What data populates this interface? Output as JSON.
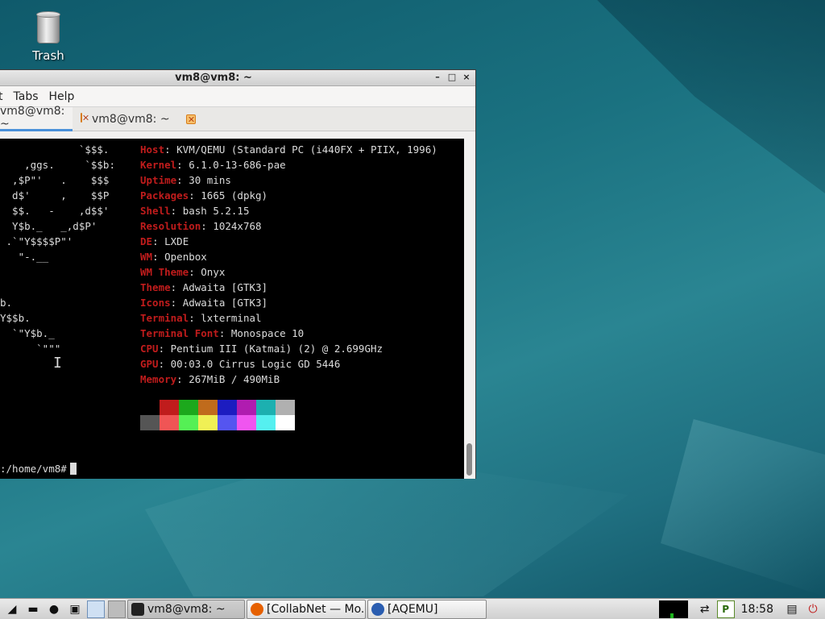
{
  "desktop": {
    "trash_label": "Trash"
  },
  "window": {
    "title": "vm8@vm8: ~",
    "buttons": {
      "minimize": "–",
      "maximize": "□",
      "close": "×"
    },
    "menu": [
      "t",
      "Tabs",
      "Help"
    ],
    "tabs": [
      {
        "label": "vm8@vm8: ~",
        "active": true
      },
      {
        "label": "vm8@vm8: ~",
        "active": false
      }
    ]
  },
  "terminal": {
    "logo": [
      "             `$$$.",
      "    ,ggs.     `$$b:",
      "  ,$P\"'   .    $$$",
      "  d$'     ,    $$P",
      "  $$.   -    ,d$$'",
      "  Y$b._   _,d$P'",
      " .`\"Y$$$$P\"'",
      "   \"-.__",
      "",
      "",
      "b.",
      "Y$$b.",
      "  `\"Y$b._",
      "      `\"\"\""
    ],
    "info": [
      {
        "key": "Host",
        "value": "KVM/QEMU (Standard PC (i440FX + PIIX, 1996)"
      },
      {
        "key": "Kernel",
        "value": "6.1.0-13-686-pae"
      },
      {
        "key": "Uptime",
        "value": "30 mins"
      },
      {
        "key": "Packages",
        "value": "1665 (dpkg)"
      },
      {
        "key": "Shell",
        "value": "bash 5.2.15"
      },
      {
        "key": "Resolution",
        "value": "1024x768"
      },
      {
        "key": "DE",
        "value": "LXDE"
      },
      {
        "key": "WM",
        "value": "Openbox"
      },
      {
        "key": "WM Theme",
        "value": "Onyx"
      },
      {
        "key": "Theme",
        "value": "Adwaita [GTK3]"
      },
      {
        "key": "Icons",
        "value": "Adwaita [GTK3]"
      },
      {
        "key": "Terminal",
        "value": "lxterminal"
      },
      {
        "key": "Terminal Font",
        "value": "Monospace 10"
      },
      {
        "key": "CPU",
        "value": "Pentium III (Katmai) (2) @ 2.699GHz"
      },
      {
        "key": "GPU",
        "value": "00:03.0 Cirrus Logic GD 5446"
      },
      {
        "key": "Memory",
        "value": "267MiB / 490MiB"
      }
    ],
    "palette_row1": [
      "#000000",
      "#c01c1c",
      "#1ca81c",
      "#c06b1c",
      "#1c1cc0",
      "#b01cb0",
      "#1cb0b0",
      "#b0b0b0"
    ],
    "palette_row2": [
      "#555555",
      "#f05555",
      "#55f055",
      "#f0f055",
      "#5555f0",
      "#f055f0",
      "#55f0f0",
      "#ffffff"
    ],
    "prompt": ":/home/vm8#"
  },
  "taskbar": {
    "tasks": [
      {
        "label": "vm8@vm8: ~",
        "icon_color": "#222222",
        "active": true
      },
      {
        "label": "[CollabNet — Mo...",
        "icon_color": "#e66000",
        "active": false
      },
      {
        "label": "[AQEMU]",
        "icon_color": "#2a5db0",
        "active": false
      }
    ],
    "clock": "18:58"
  }
}
